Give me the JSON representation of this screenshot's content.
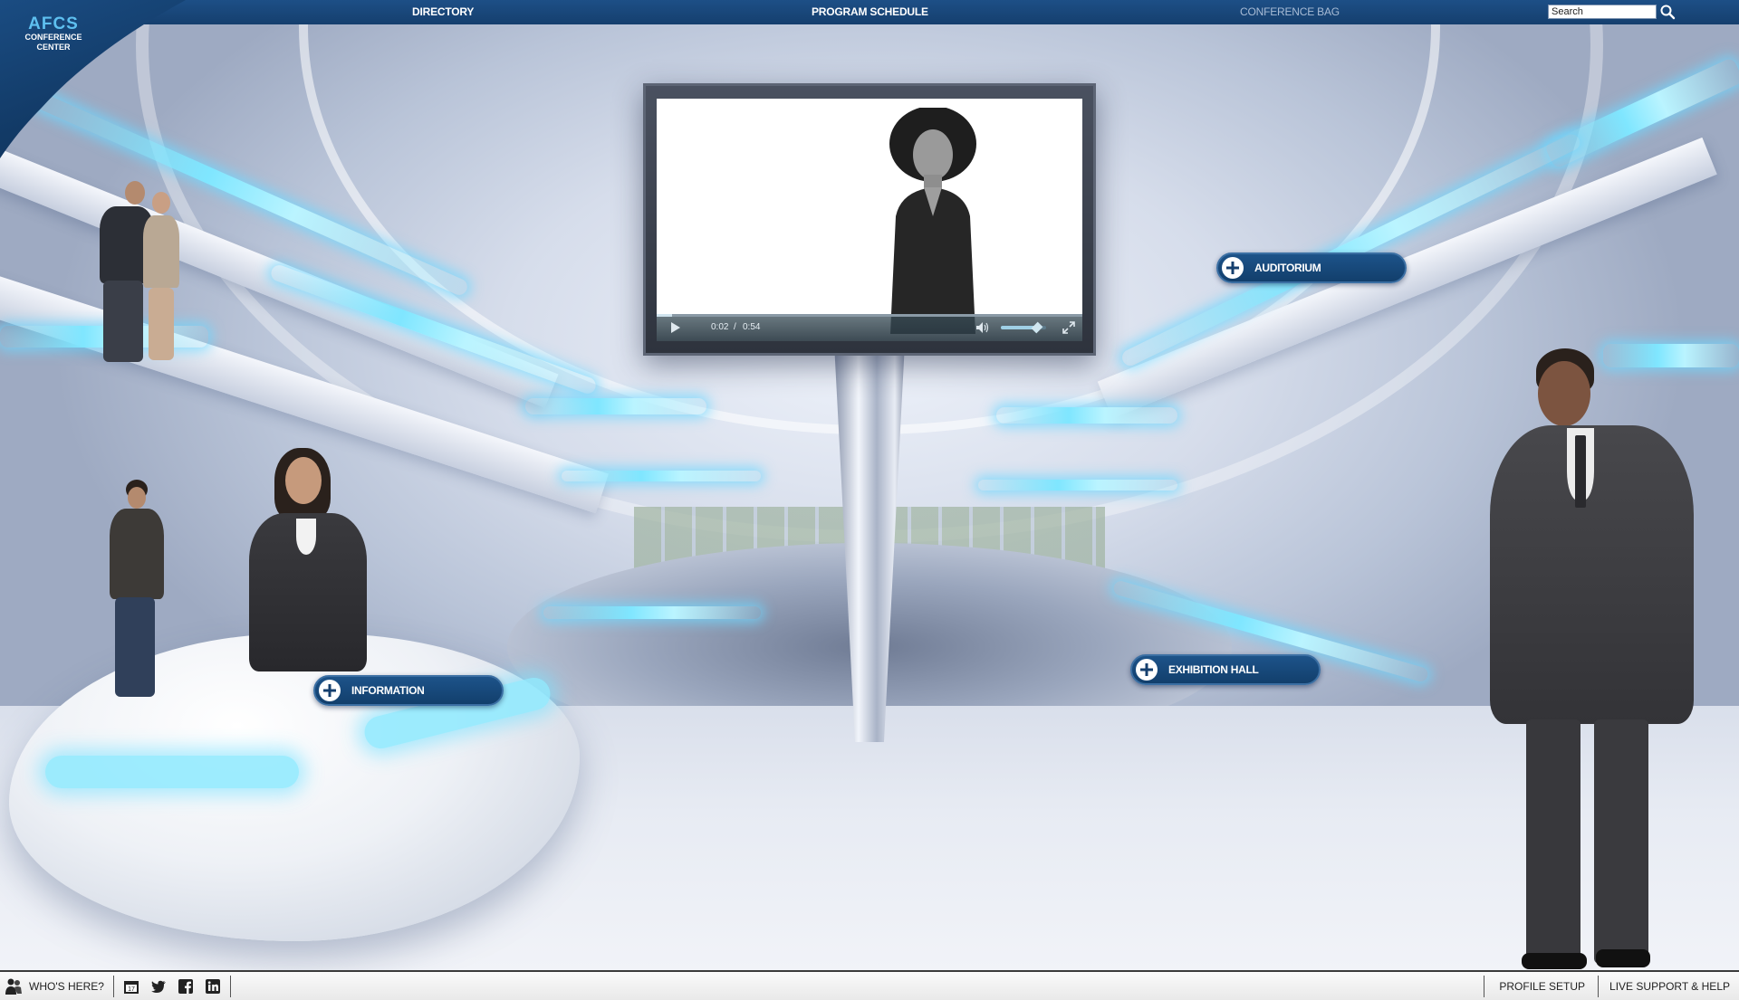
{
  "logo": {
    "name": "AFCS",
    "line1": "CONFERENCE",
    "line2": "CENTER"
  },
  "nav": {
    "directory": "DIRECTORY",
    "program_schedule": "PROGRAM SCHEDULE",
    "conference_bag": "CONFERENCE BAG",
    "search_placeholder": "Search"
  },
  "video": {
    "current_time": "0:02",
    "separator": "/",
    "duration": "0:54",
    "progress_fraction": 0.037,
    "volume_fraction": 0.8
  },
  "hotspots": {
    "auditorium": "AUDITORIUM",
    "information": "INFORMATION",
    "exhibition_hall": "EXHIBITION HALL"
  },
  "bottom": {
    "whos_here": "WHO'S HERE?",
    "calendar_day": "17",
    "profile_setup": "PROFILE SETUP",
    "live_support": "LIVE SUPPORT & HELP"
  },
  "colors": {
    "nav_blue": "#153f6e",
    "accent_cyan": "#7fe6ff",
    "hotspot_blue": "#1d5389"
  },
  "icons": [
    "search-icon",
    "play-icon",
    "volume-icon",
    "fullscreen-icon",
    "plus-icon",
    "people-icon",
    "calendar-icon",
    "twitter-icon",
    "facebook-icon",
    "linkedin-icon"
  ]
}
